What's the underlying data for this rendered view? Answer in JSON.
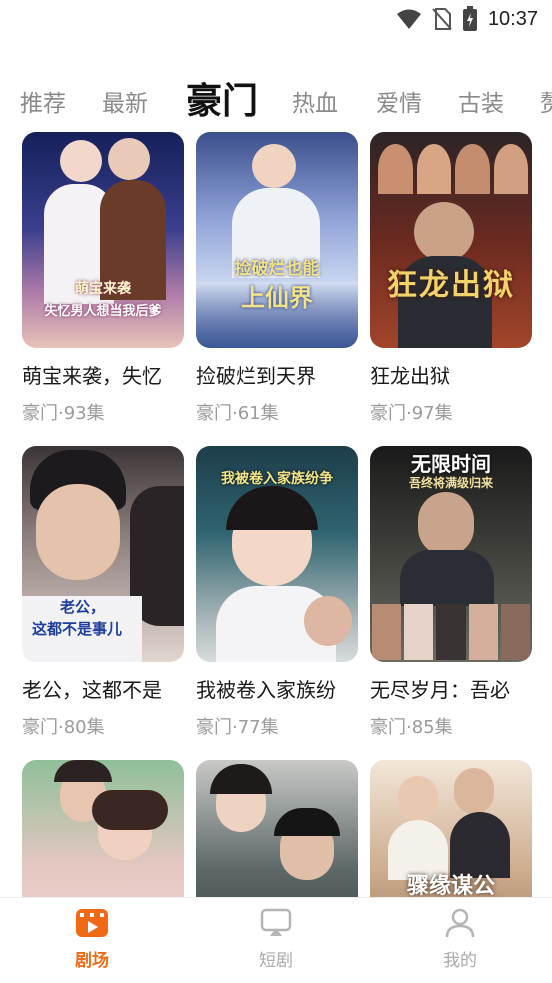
{
  "status": {
    "time": "10:37"
  },
  "tabs": [
    {
      "label": "推荐"
    },
    {
      "label": "最新"
    },
    {
      "label": "豪门"
    },
    {
      "label": "热血"
    },
    {
      "label": "爱情"
    },
    {
      "label": "古装"
    },
    {
      "label": "赘"
    }
  ],
  "cards": [
    {
      "title": "萌宝来袭，失忆",
      "meta": "豪门·93集",
      "poster_text": [
        "萌宝来袭",
        "失忆男人想当我后爹"
      ],
      "palette": "#1d2a6b"
    },
    {
      "title": "捡破烂到天界",
      "meta": "豪门·61集",
      "poster_text": [
        "捡破烂也能",
        "上仙界"
      ],
      "palette": "#7c8fc8"
    },
    {
      "title": "狂龙出狱",
      "meta": "豪门·97集",
      "poster_text": [
        "狂龙出狱"
      ],
      "palette": "#5b1f18"
    },
    {
      "title": "老公，这都不是",
      "meta": "豪门·80集",
      "poster_text": [
        "老公，",
        "这都不是事儿"
      ],
      "palette": "#d8c2b6"
    },
    {
      "title": "我被卷入家族纷",
      "meta": "豪门·77集",
      "poster_text": [
        "我被卷入家族纷争"
      ],
      "palette": "#2a4f5a"
    },
    {
      "title": "无尽岁月：吾必",
      "meta": "豪门·85集",
      "poster_text": [
        "无限时间",
        "吾终将满级归来"
      ],
      "palette": "#3a3a36"
    },
    {
      "title": "",
      "meta": "",
      "poster_text": [],
      "palette": "#e6c7c2"
    },
    {
      "title": "",
      "meta": "",
      "poster_text": [],
      "palette": "#3e4a4f"
    },
    {
      "title": "",
      "meta": "",
      "poster_text": [
        "骤缘谋公"
      ],
      "palette": "#b88a63"
    }
  ],
  "bottom_nav": [
    {
      "label": "剧场",
      "icon": "theater-icon",
      "active": true
    },
    {
      "label": "短剧",
      "icon": "tv-icon",
      "active": false
    },
    {
      "label": "我的",
      "icon": "user-icon",
      "active": false
    }
  ],
  "colors": {
    "accent": "#f06a16",
    "muted": "#9b9b9b"
  }
}
